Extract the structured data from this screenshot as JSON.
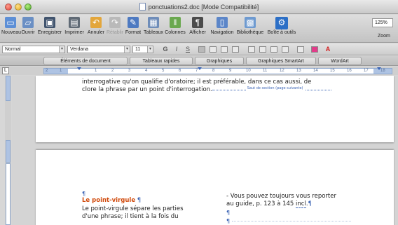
{
  "window": {
    "title": "ponctuations2.doc [Mode Compatibilité]"
  },
  "toolbar": {
    "buttons": [
      {
        "name": "nouveau",
        "label": "Nouveau",
        "icon": "new-doc-icon",
        "color": "#5d8fd6"
      },
      {
        "name": "ouvrir",
        "label": "Ouvrir",
        "icon": "open-folder-icon",
        "color": "#6a8fc4"
      },
      {
        "name": "enregistrer",
        "label": "Enregistrer",
        "icon": "save-disk-icon",
        "color": "#41546e"
      },
      {
        "name": "imprimer",
        "label": "Imprimer",
        "icon": "printer-icon",
        "color": "#606a75"
      },
      {
        "name": "annuler",
        "label": "Annuler",
        "icon": "undo-icon",
        "color": "#e3a63b"
      },
      {
        "name": "retablir",
        "label": "Rétablir",
        "icon": "redo-icon",
        "color": "#b9b9b9",
        "disabled": true
      },
      {
        "name": "format",
        "label": "Format",
        "icon": "format-brush-icon",
        "color": "#4e7ac1"
      },
      {
        "name": "tableaux",
        "label": "Tableaux",
        "icon": "table-grid-icon",
        "color": "#6f8db9"
      },
      {
        "name": "colonnes",
        "label": "Colonnes",
        "icon": "columns-icon",
        "color": "#6aa84f"
      },
      {
        "name": "afficher",
        "label": "Afficher",
        "icon": "pilcrow-icon",
        "color": "#4b4b4b"
      },
      {
        "name": "navigation",
        "label": "Navigation",
        "icon": "navigation-pane-icon",
        "color": "#5c86c8"
      },
      {
        "name": "bibliotheque",
        "label": "Bibliothèque",
        "icon": "media-library-icon",
        "color": "#6e9ad0"
      },
      {
        "name": "boite-a-outils",
        "label": "Boîte à outils",
        "icon": "toolbox-icon",
        "color": "#2c6fc6"
      }
    ],
    "zoom_value": "125%",
    "zoom_label": "Zoom"
  },
  "formatbar": {
    "style_value": "Normal",
    "font_value": "Verdana",
    "size_value": "11",
    "bold": "G",
    "italic": "I",
    "underline": "S"
  },
  "ribbon": {
    "tabs": [
      {
        "label": "Éléments de document"
      },
      {
        "label": "Tableaux rapides"
      },
      {
        "label": "Graphiques"
      },
      {
        "label": "Graphiques SmartArt"
      },
      {
        "label": "WordArt"
      }
    ]
  },
  "ruler": {
    "tab_selector": "L",
    "ticks": [
      "2",
      "1",
      "1",
      "2",
      "3",
      "4",
      "5",
      "6",
      "7",
      "8",
      "9",
      "10",
      "11",
      "12",
      "13",
      "14",
      "15",
      "16",
      "17",
      "18"
    ]
  },
  "document": {
    "page1": {
      "line1": "interrogative qu'on qualifie d'oratoire; il est préférable, dans ce cas aussi, de",
      "line2": "clore la phrase par un point d'interrogation.",
      "section_break": "Saut de section (page suivante)"
    },
    "page2": {
      "left_mark": "¶",
      "heading": "Le point-virgule",
      "heading_mark": "¶",
      "left_line1": "Le point-virgule sépare les parties",
      "left_line2": "d'une phrase; il tient à la fois du",
      "right_line1": "- Vous pouvez toujours vous reporter",
      "right_line2_a": "au guide, p. 123 à 145 ",
      "right_line2_b": "incl",
      "right_line2_c": ".",
      "right_mark": "¶",
      "arrow1": "¶",
      "arrow2": "¶"
    }
  },
  "colors": {
    "pilcrow_blue": "#3b64b5",
    "heading_orange": "#d04a0c",
    "ruler_margin": "#aec3e3"
  }
}
